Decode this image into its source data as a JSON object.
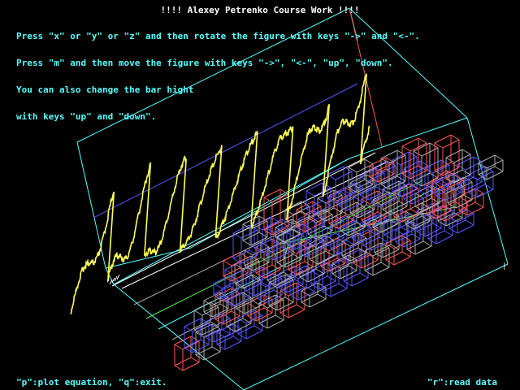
{
  "title": "!!!! Alexey Petrenko Course Work !!!!",
  "instructions": [
    "Press \"x\" or \"y\" or \"z\" and then rotate the figure with keys \"->\" and \"<-\".",
    "Press \"m\" and then move the figure with keys \"->\", \"<-\", \"up\", \"down\".",
    "You can also change the bar hight",
    "with keys \"up\" and \"down\"."
  ],
  "footer": {
    "left": "\"p\":plot equation, \"q\":exit.",
    "right": "\"r\":read data"
  },
  "colors": {
    "background": "#000000",
    "title": "#ffffff",
    "text": "#55ffff",
    "wireframe": "#55ffff",
    "curve": "#ffff55",
    "axis": "#5555ff",
    "bar_red": "#ff5555",
    "bar_blue": "#5555ff",
    "bar_grey": "#aaaaaa",
    "bar_green": "#55ff55"
  }
}
